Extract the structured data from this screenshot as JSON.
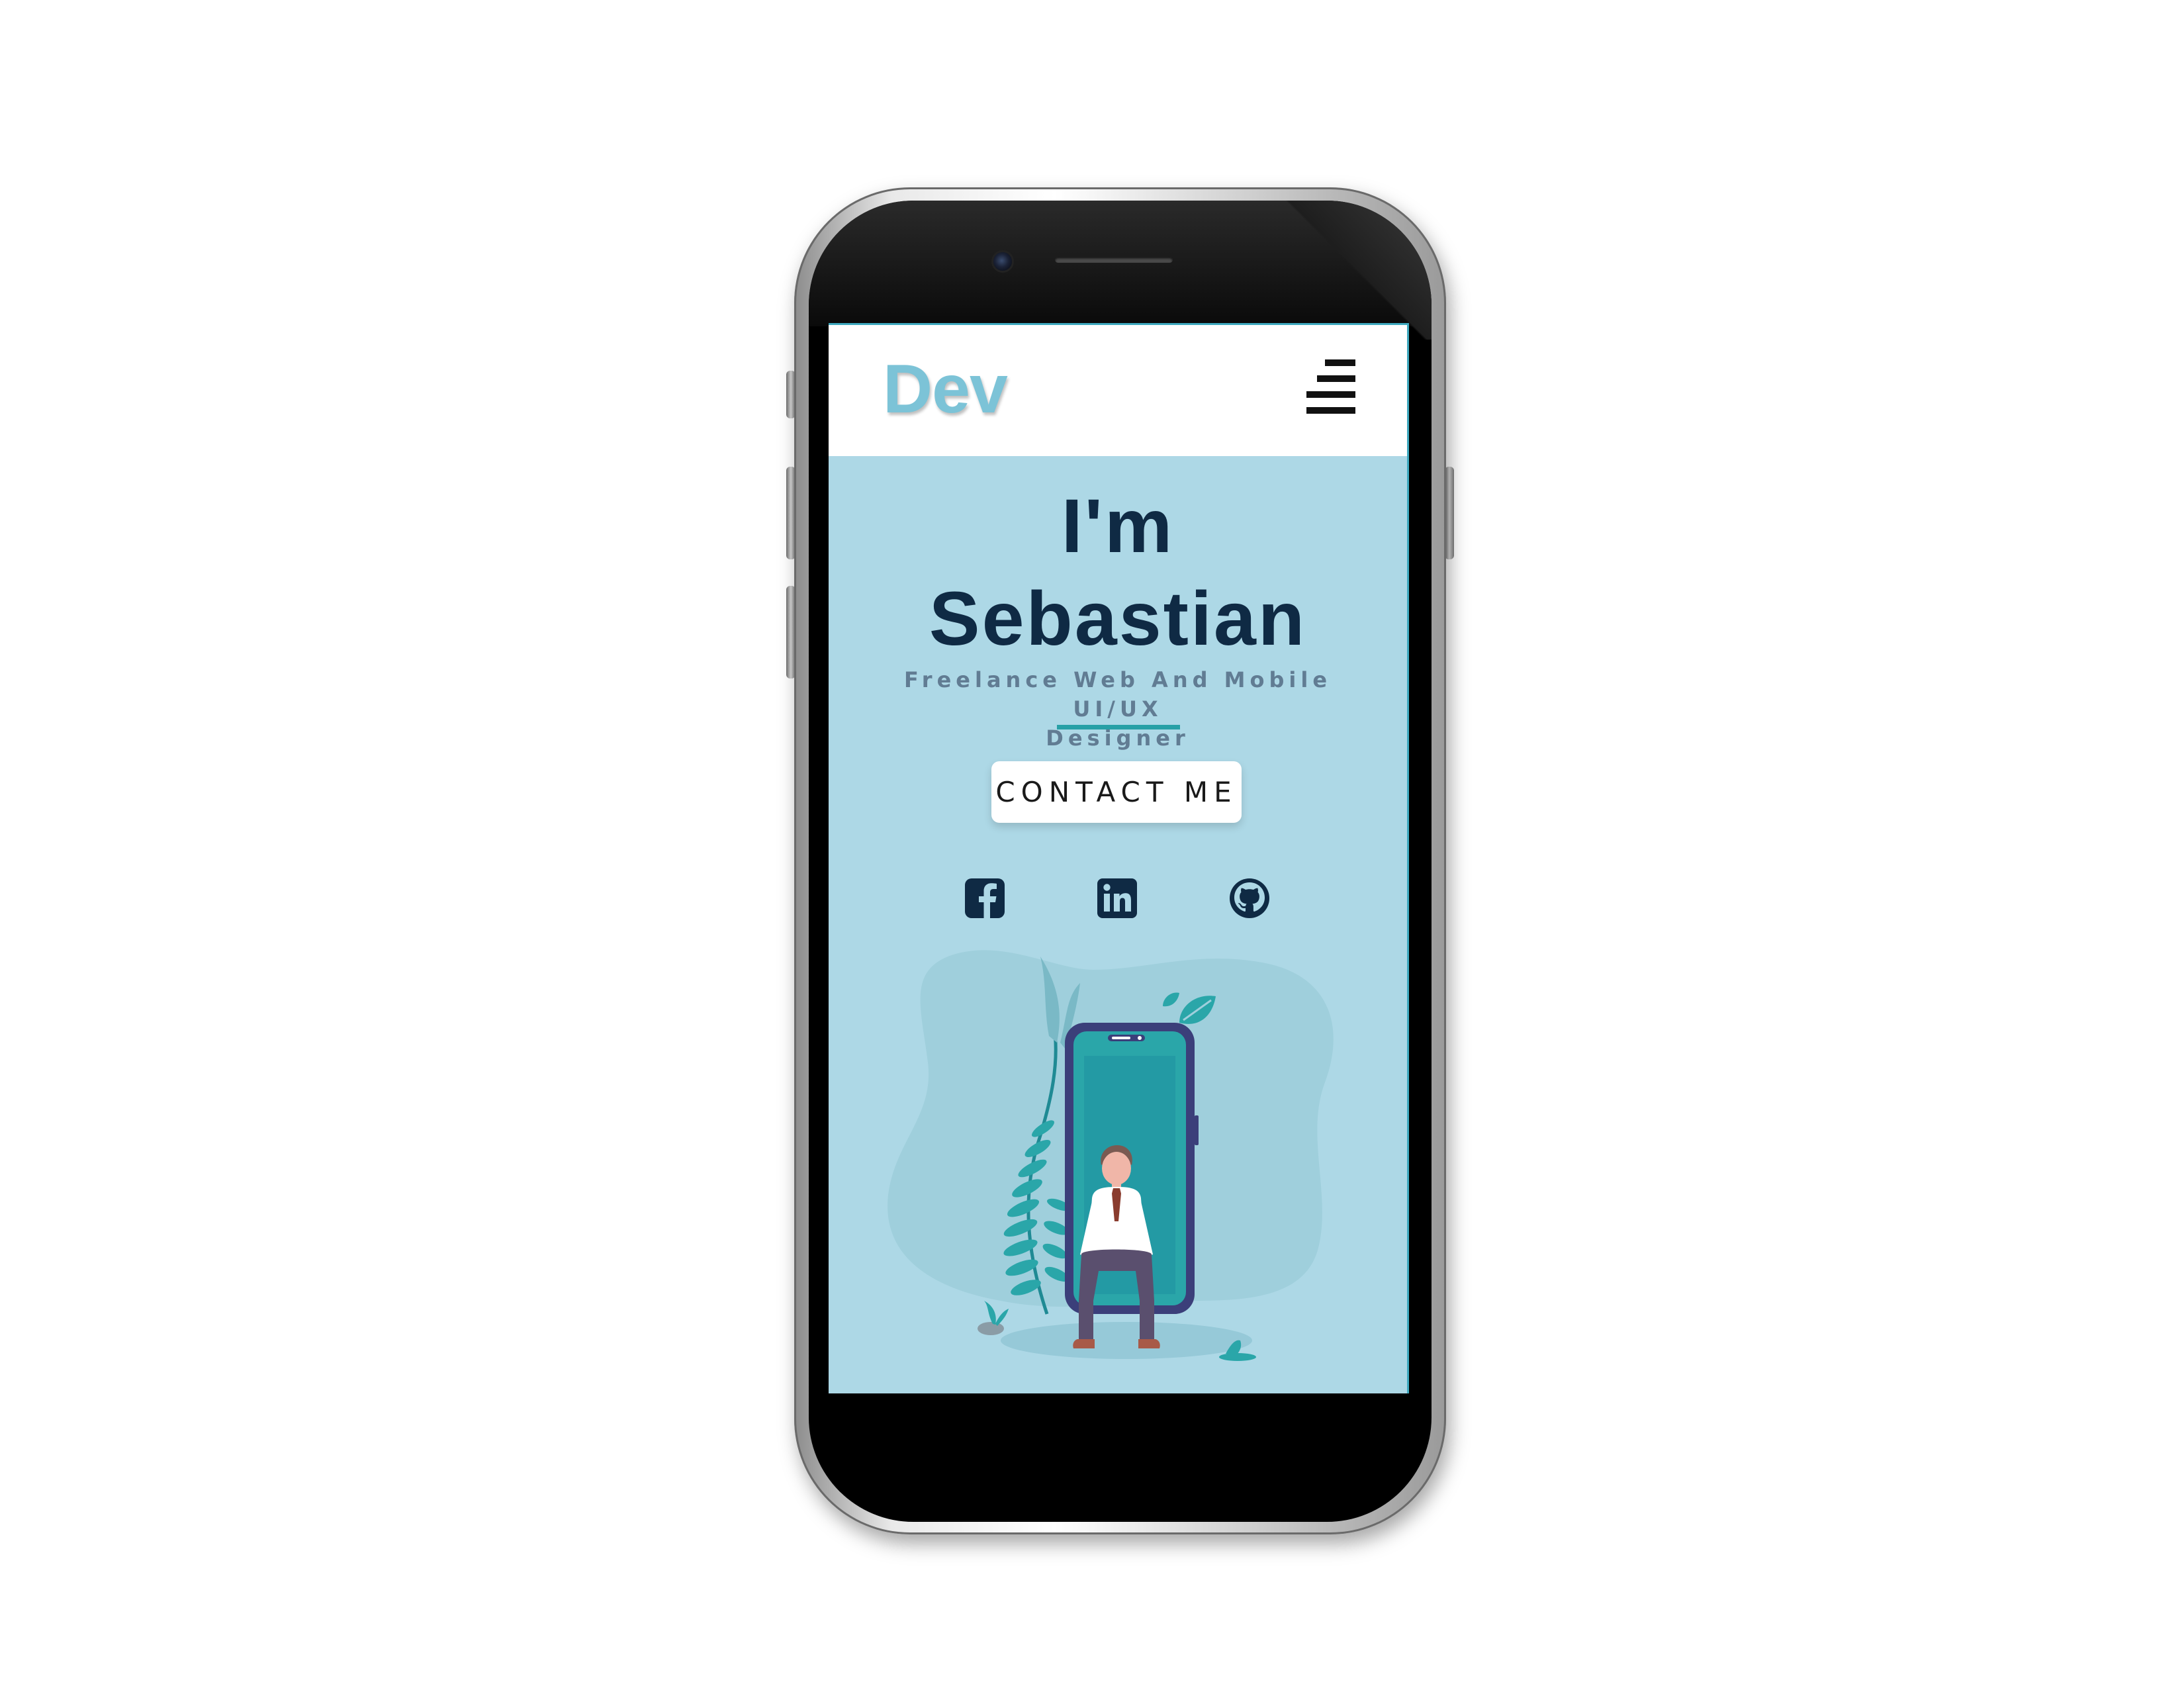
{
  "app": {
    "logo": "Dev"
  },
  "hero": {
    "greeting": "I'm",
    "name": "Sebastian",
    "role_line1": "Freelance Web And Mobile UI/UX",
    "role_line2": "Designer",
    "contact_label": "CONTACT ME"
  },
  "social": [
    {
      "icon": "facebook-icon"
    },
    {
      "icon": "linkedin-icon"
    },
    {
      "icon": "github-icon"
    }
  ],
  "colors": {
    "screen_background": "#add8e6",
    "logo": "#7cc3d7",
    "heading": "#0f2a44",
    "subtitle": "#617c93",
    "accent": "#27a0a6"
  }
}
